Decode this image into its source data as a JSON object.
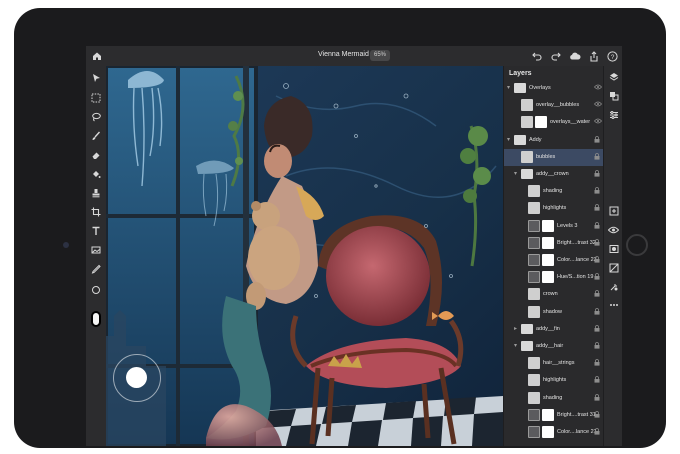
{
  "app": {
    "document_title": "Vienna Mermaid",
    "zoom": "65%"
  },
  "icons": {
    "home": "home-icon",
    "undo": "undo-icon",
    "redo": "redo-icon",
    "cloud": "cloud-icon",
    "share": "share-icon",
    "help": "help-icon"
  },
  "layers_panel": {
    "title": "Layers",
    "rows": [
      {
        "label": "Overlays",
        "kind": "group",
        "depth": 0,
        "expanded": true,
        "right": "eye"
      },
      {
        "label": "overlay__bubbles",
        "kind": "image",
        "depth": 1,
        "right": "eye"
      },
      {
        "label": "overlays__water",
        "kind": "image-mask",
        "depth": 1,
        "right": "eye"
      },
      {
        "label": "Addy",
        "kind": "group",
        "depth": 0,
        "expanded": true,
        "right": "lock"
      },
      {
        "label": "bubbles",
        "kind": "image",
        "depth": 1,
        "right": "lock",
        "selected": true
      },
      {
        "label": "addy__crown",
        "kind": "group",
        "depth": 1,
        "expanded": true,
        "right": "lock"
      },
      {
        "label": "shading",
        "kind": "image",
        "depth": 2,
        "right": "lock"
      },
      {
        "label": "highlights",
        "kind": "image",
        "depth": 2,
        "right": "lock"
      },
      {
        "label": "Levels 3",
        "kind": "adjust",
        "depth": 2,
        "right": "lock"
      },
      {
        "label": "Bright....trast 32",
        "kind": "adjust",
        "depth": 2,
        "right": "lock"
      },
      {
        "label": "Color....lance 23",
        "kind": "adjust",
        "depth": 2,
        "right": "lock"
      },
      {
        "label": "Hue/S...tion 19",
        "kind": "adjust",
        "depth": 2,
        "right": "lock"
      },
      {
        "label": "crown",
        "kind": "image",
        "depth": 2,
        "right": "lock"
      },
      {
        "label": "shadow",
        "kind": "image",
        "depth": 2,
        "right": "lock"
      },
      {
        "label": "addy__fin",
        "kind": "group",
        "depth": 1,
        "expanded": false,
        "right": "lock"
      },
      {
        "label": "addy__hair",
        "kind": "group",
        "depth": 1,
        "expanded": true,
        "right": "lock"
      },
      {
        "label": "hair__strings",
        "kind": "image",
        "depth": 2,
        "right": "lock"
      },
      {
        "label": "highlights",
        "kind": "image",
        "depth": 2,
        "right": "lock"
      },
      {
        "label": "shading",
        "kind": "image",
        "depth": 2,
        "right": "lock"
      },
      {
        "label": "Bright....trast 31",
        "kind": "adjust",
        "depth": 2,
        "right": "lock"
      },
      {
        "label": "Color....lance 21",
        "kind": "adjust",
        "depth": 2,
        "right": "lock"
      }
    ]
  },
  "colors": {
    "selection": "#3c4a63",
    "panel_bg": "#2a2a2c"
  }
}
